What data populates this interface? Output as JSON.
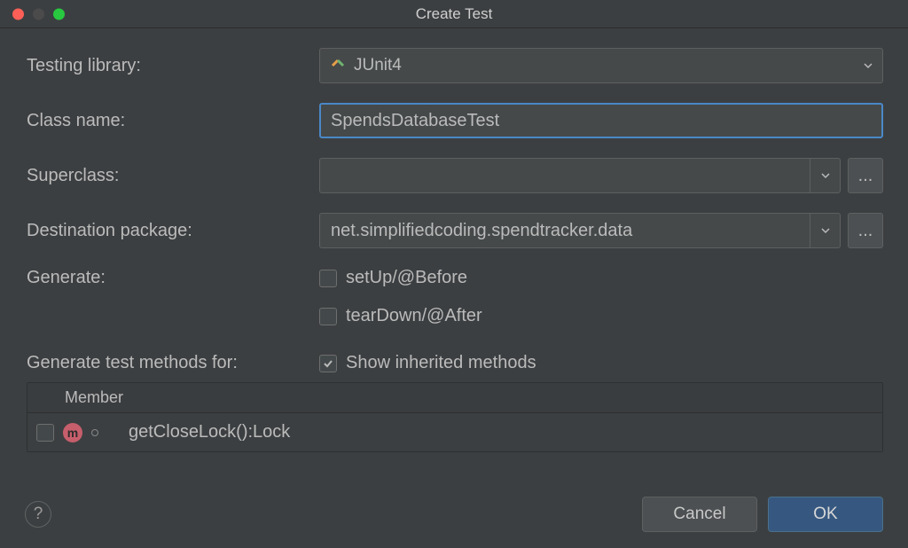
{
  "title": "Create Test",
  "labels": {
    "testing_library": "Testing library:",
    "class_name": "Class name:",
    "superclass": "Superclass:",
    "destination_package": "Destination package:",
    "generate": "Generate:",
    "generate_test_methods_for": "Generate test methods for:"
  },
  "fields": {
    "testing_library_value": "JUnit4",
    "class_name_value": "SpendsDatabaseTest",
    "superclass_value": "",
    "destination_package_value": "net.simplifiedcoding.spendtracker.data"
  },
  "checkboxes": {
    "setup_label": "setUp/@Before",
    "setup_checked": false,
    "teardown_label": "tearDown/@After",
    "teardown_checked": false,
    "show_inherited_label": "Show inherited methods",
    "show_inherited_checked": true
  },
  "member_table": {
    "header": "Member",
    "rows": [
      {
        "checked": false,
        "name": "getCloseLock():Lock"
      }
    ]
  },
  "buttons": {
    "cancel": "Cancel",
    "ok": "OK",
    "help": "?",
    "ellipsis": "..."
  }
}
